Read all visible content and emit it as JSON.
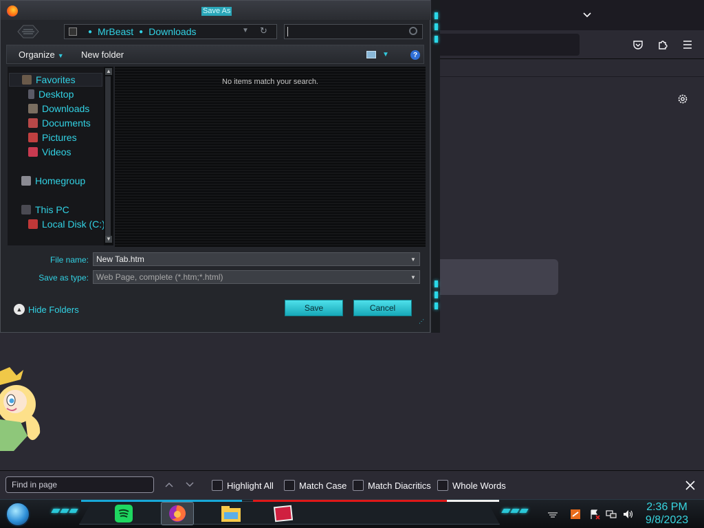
{
  "firefox": {
    "icons": {
      "tabs_dropdown": "chevron-down-icon",
      "pocket": "pocket-icon",
      "extensions": "puzzle-icon",
      "menu": "hamburger-menu-icon",
      "settings": "gear-icon"
    }
  },
  "dialog": {
    "title": "Save As",
    "breadcrumb": [
      "MrBeast",
      "Downloads"
    ],
    "toolbar": {
      "organize": "Organize",
      "new_folder": "New folder"
    },
    "nav": {
      "favorites": "Favorites",
      "desktop": "Desktop",
      "downloads": "Downloads",
      "documents": "Documents",
      "pictures": "Pictures",
      "videos": "Videos",
      "homegroup": "Homegroup",
      "this_pc": "This PC",
      "local_disk": "Local Disk (C:)"
    },
    "empty_message": "No items match your search.",
    "file_name_label": "File name:",
    "file_name_value": "New Tab.htm",
    "save_type_label": "Save as type:",
    "save_type_value": "Web Page, complete (*.htm;*.html)",
    "hide_folders": "Hide Folders",
    "save_button": "Save",
    "cancel_button": "Cancel",
    "accent_color": "#32d2e4"
  },
  "findbar": {
    "placeholder": "Find in page",
    "highlight_all": "Highlight All",
    "match_case": "Match Case",
    "match_diacritics": "Match Diacritics",
    "whole_words": "Whole Words"
  },
  "taskbar": {
    "apps": [
      "spotify-icon",
      "firefox-icon",
      "file-explorer-icon",
      "media-player-icon"
    ],
    "time": "2:36 PM",
    "date": "9/8/2023",
    "tray_icons": [
      "network-icon",
      "flag-icon",
      "volume-icon"
    ]
  }
}
